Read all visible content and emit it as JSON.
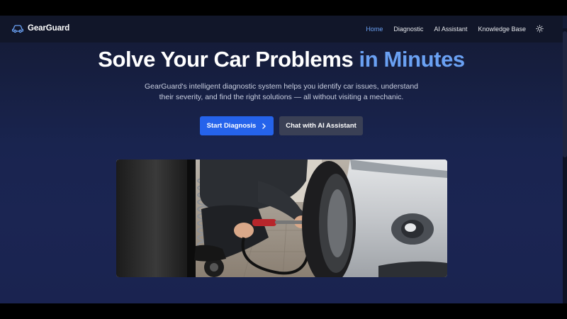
{
  "brand": {
    "name": "GearGuard",
    "icon": "car-icon"
  },
  "nav": {
    "items": [
      {
        "label": "Home",
        "active": true
      },
      {
        "label": "Diagnostic",
        "active": false
      },
      {
        "label": "AI Assistant",
        "active": false
      },
      {
        "label": "Knowledge Base",
        "active": false
      }
    ],
    "theme_icon": "sun-icon"
  },
  "hero": {
    "title_main": "Solve Your Car Problems",
    "title_accent": "in Minutes",
    "subtitle_line1": "GearGuard's intelligent diagnostic system helps you identify car issues, understand",
    "subtitle_line2": "their severity, and find the right solutions — all without visiting a mechanic.",
    "primary_button": "Start Diagnosis",
    "secondary_button": "Chat with AI Assistant",
    "image_alt": "Mechanic inflating a car tire"
  },
  "colors": {
    "accent": "#6aa1f3",
    "primary_button": "#2563eb",
    "secondary_button": "#3a4055",
    "navbar": "#111629",
    "background": "#19244f"
  }
}
